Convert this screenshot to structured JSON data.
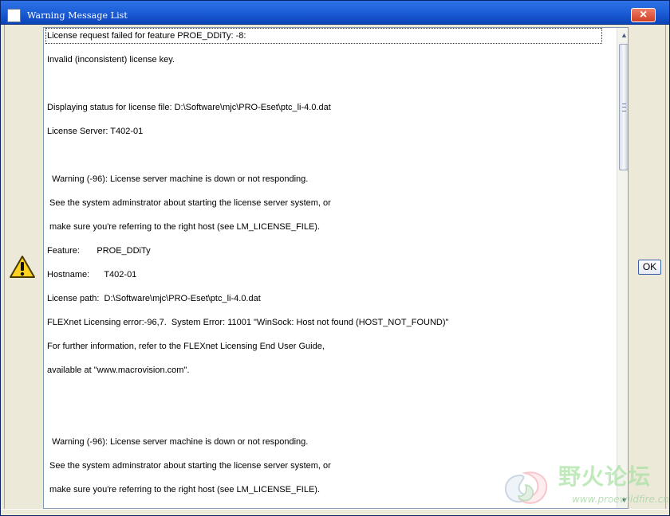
{
  "window": {
    "title": "Warning Message List",
    "close_label": "×",
    "ok_label": "OK"
  },
  "messages": [
    {
      "text": "License request failed for feature PROE_DDiTy: -8:"
    },
    {
      "text": "Invalid (inconsistent) license key."
    },
    {
      "text": ""
    },
    {
      "text": "Displaying status for license file: D:\\Software\\mjc\\PRO-Eset\\ptc_li-4.0.dat"
    },
    {
      "text": "License Server: T402-01"
    },
    {
      "text": ""
    },
    {
      "text": "  Warning (-96): License server machine is down or not responding."
    },
    {
      "text": " See the system adminstrator about starting the license server system, or"
    },
    {
      "text": " make sure you're referring to the right host (see LM_LICENSE_FILE)."
    },
    {
      "text": "Feature:       PROE_DDiTy"
    },
    {
      "text": "Hostname:      T402-01"
    },
    {
      "text": "License path:  D:\\Software\\mjc\\PRO-Eset\\ptc_li-4.0.dat"
    },
    {
      "text": "FLEXnet Licensing error:-96,7.  System Error: 11001 \"WinSock: Host not found (HOST_NOT_FOUND)\""
    },
    {
      "text": "For further information, refer to the FLEXnet Licensing End User Guide,"
    },
    {
      "text": "available at \"www.macrovision.com\"."
    },
    {
      "text": ""
    },
    {
      "text": ""
    },
    {
      "text": "  Warning (-96): License server machine is down or not responding."
    },
    {
      "text": " See the system adminstrator about starting the license server system, or"
    },
    {
      "text": " make sure you're referring to the right host (see LM_LICENSE_FILE)."
    }
  ],
  "watermark": {
    "title": "野火论坛",
    "url": "www.proewildfire.cn"
  },
  "icons": {
    "window": "document-icon",
    "warning": "warning-icon",
    "close": "close-icon",
    "scroll_up": "chevron-up-icon",
    "scroll_down": "chevron-down-icon"
  },
  "colors": {
    "title_bar": "#1d5fd7",
    "warning": "#ffd200",
    "panel": "#ffffff"
  }
}
